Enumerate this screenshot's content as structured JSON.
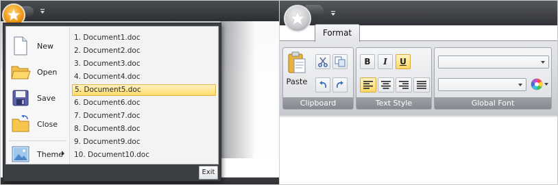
{
  "app_menu": {
    "commands": [
      {
        "label": "New",
        "icon": "new-document-icon"
      },
      {
        "label": "Open",
        "icon": "open-folder-icon"
      },
      {
        "label": "Save",
        "icon": "floppy-disk-icon"
      },
      {
        "label": "Close",
        "icon": "close-folder-icon"
      },
      {
        "label": "Theme",
        "icon": "theme-picture-icon"
      }
    ],
    "recent_documents": [
      "1. Document1.doc",
      "2. Document2.doc",
      "3. Document3.doc",
      "4. Document4.doc",
      "5. Document5.doc",
      "6. Document6.doc",
      "7. Document7.doc",
      "8. Document8.doc",
      "9. Document9.doc",
      "10. Document10.doc"
    ],
    "selected_recent_index": 4,
    "exit_label": "Exit"
  },
  "ribbon": {
    "tab_label": "Format",
    "groups": {
      "clipboard": {
        "caption": "Clipboard",
        "paste_label": "Paste"
      },
      "text_style": {
        "caption": "Text Style",
        "bold_label": "B",
        "italic_label": "I",
        "underline_label": "U",
        "underline_active": true,
        "active_alignment": "left"
      },
      "global_font": {
        "caption": "Global Font",
        "font_family_value": "",
        "font_size_value": ""
      }
    }
  },
  "colors": {
    "orb_orange": "#f09a1a",
    "selection_highlight": "#ffd968",
    "group_caption": "#8f9399",
    "title_bar": "#303236"
  }
}
